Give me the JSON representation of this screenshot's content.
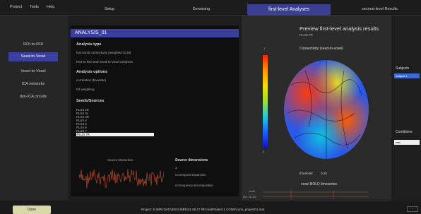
{
  "menu": {
    "project": "Project",
    "tools": "Tools",
    "help": "Help"
  },
  "tabs": {
    "setup": "Setup",
    "denoising": "Denoising",
    "first_level": "first-level Analyses",
    "second_level": "second-level Results"
  },
  "sidebar": {
    "items": [
      "ROI-to-ROI",
      "Seed-to-Voxel",
      "Voxel-to-Voxel",
      "ICA networks",
      "dyn-ICA circuits"
    ],
    "active": "Seed-to-Voxel"
  },
  "analysis": {
    "name": "ANALYSIS_01",
    "type_title": "Analysis type",
    "type_value": "functional connectivity (weighted GLM)",
    "type_scope": "ROI-to-ROI and Seed-to-Voxel analyses",
    "options_title": "Analysis options",
    "option_measure": "correlation (bivariate)",
    "option_weighting": "hrf weighting",
    "seeds_title": "Seeds/Sources",
    "seeds": [
      "PLUS 2R",
      "PLUS 3L",
      "PLUS 3R",
      "PLUS 4",
      "PLUS 5",
      "PLUS 6",
      "PLUS 7",
      "PLUS 7R"
    ],
    "selected_seed": "PLUS 7R",
    "source_timeseries_label": "Source timeseries",
    "source_dimensions_title": "Source dimensions",
    "source_dimensions_value": "1",
    "source_temporal": "no temporal expansion",
    "source_frequency": "no frequency decomposition"
  },
  "preview": {
    "title": "Preview first-level analysis results",
    "subtitle": "PLUS 7R",
    "map_label": "Connectivity (seed-to-voxel)",
    "colorbar_top": "1",
    "colorbar_bottom": "-1",
    "threshold_label": "threshold",
    "threshold_value": "0.25",
    "bold_label": "voxel BOLD timeseries",
    "coords_label": "voxel",
    "coords_value": "(38,-76,10)"
  },
  "right": {
    "subjects_label": "Subjects",
    "subject_selected": "Subject 1",
    "conditions_label": "Conditions",
    "condition_value": "rest"
  },
  "bottom": {
    "done": "Done",
    "project_path": "Project: E:\\MRI DATA\\EEG-fMRI\\21.06.17 RR rest\\Patient 1 CONN\\conn_project01.mat",
    "dots": "···"
  },
  "colors": {
    "accent": "#3b3f94",
    "panel": "#0f0f0f",
    "done_button": "#d8d8a8",
    "trace": "#c8502a"
  }
}
